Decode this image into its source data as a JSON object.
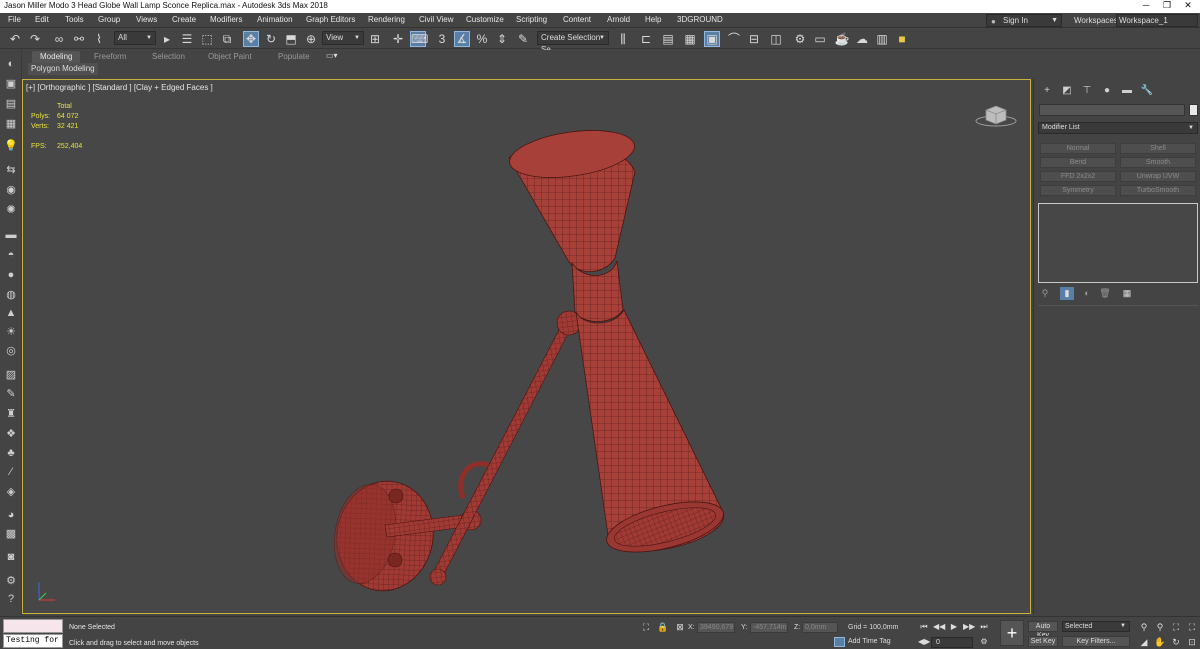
{
  "window": {
    "title": "Jason Miller Modo 3 Head Globe Wall Lamp Sconce Replica.max - Autodesk 3ds Max 2018",
    "minimize": "─",
    "maximize": "❐",
    "close": "✕"
  },
  "menu": [
    "File",
    "Edit",
    "Tools",
    "Group",
    "Views",
    "Create",
    "Modifiers",
    "Animation",
    "Graph Editors",
    "Rendering",
    "Civil View",
    "Customize",
    "Scripting",
    "Content",
    "Arnold",
    "Help",
    "3DGROUND"
  ],
  "account": {
    "sign_in": "Sign In",
    "workspaces_label": "Workspaces:",
    "workspace": "Workspace_1"
  },
  "toolbar": {
    "selection_filter": "All",
    "ref_coord": "View",
    "selection_set": "Create Selection Se"
  },
  "ribbon": {
    "tabs": [
      "Modeling",
      "Freeform",
      "Selection",
      "Object Paint",
      "Populate"
    ],
    "active_tab": "Modeling",
    "sub_panel": "Polygon Modeling"
  },
  "viewport": {
    "label": "[+] [Orthographic ] [Standard ] [Clay + Edged Faces ]",
    "stats": {
      "total_label": "Total",
      "polys_label": "Polys:",
      "polys": "64 072",
      "verts_label": "Verts:",
      "verts": "32 421",
      "fps_label": "FPS:",
      "fps": "252,404"
    },
    "model_color": "#a8403a",
    "border_color": "#c9b23a"
  },
  "command_panel": {
    "modifier_list": "Modifier List",
    "modifier_buttons": [
      "Normal",
      "Shell",
      "Bend",
      "Smooth",
      "FFD 2x2x2",
      "Unwrap UVW",
      "Symmetry",
      "TurboSmooth"
    ]
  },
  "status": {
    "testing": "Testing for ;",
    "selection": "None Selected",
    "prompt": "Click and drag to select and move objects",
    "x_label": "X:",
    "x_value": "39490,679",
    "y_label": "Y:",
    "y_value": "-457,714m",
    "z_label": "Z:",
    "z_value": "0,0mm",
    "grid": "Grid = 100,0mm",
    "add_time_tag": "Add Time Tag",
    "frame": "0",
    "auto_key": "Auto Key",
    "set_key": "Set Key",
    "key_mode": "Selected",
    "key_filters": "Key Filters..."
  }
}
